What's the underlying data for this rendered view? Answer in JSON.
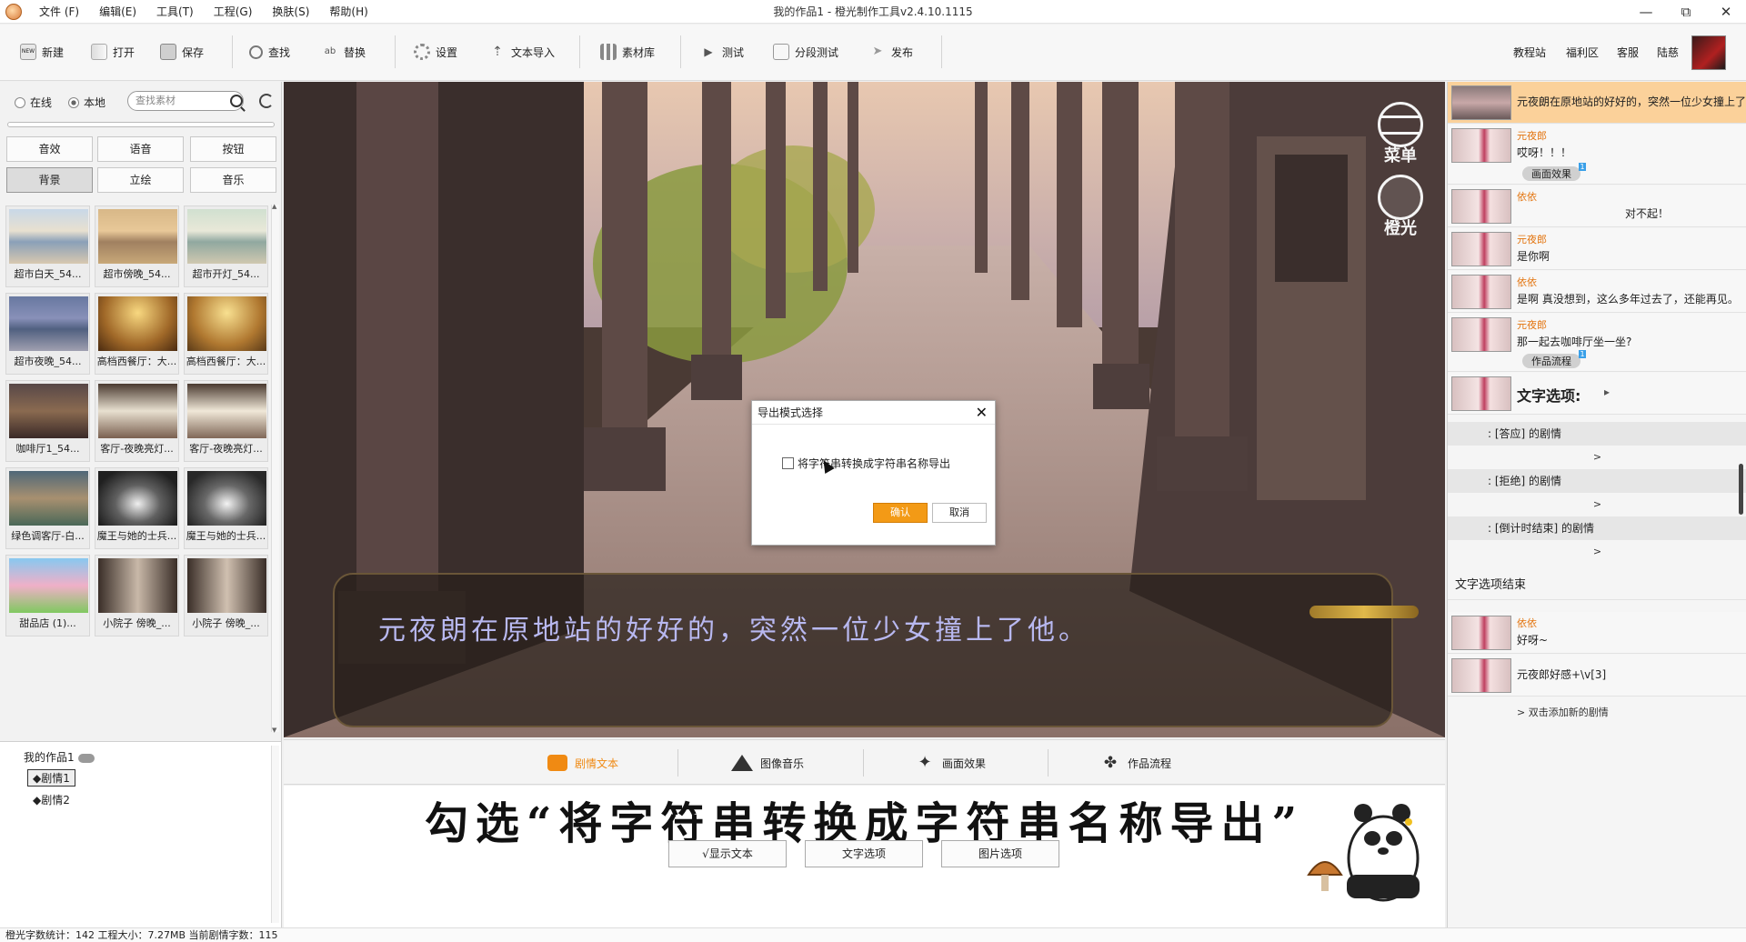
{
  "window": {
    "title": "我的作品1 - 橙光制作工具v2.4.10.1115",
    "controls": [
      "—",
      "⧉",
      "✕"
    ]
  },
  "menu": [
    "文件 (F)",
    "编辑(E)",
    "工具(T)",
    "工程(G)",
    "换肤(S)",
    "帮助(H)"
  ],
  "toolbar": {
    "new": "新建",
    "open": "打开",
    "save": "保存",
    "find": "查找",
    "replace": "替换",
    "settings": "设置",
    "text_import": "文本导入",
    "assets": "素材库",
    "test": "测试",
    "segment_test": "分段测试",
    "publish": "发布",
    "links": [
      "教程站",
      "福利区",
      "客服",
      "陆慈"
    ]
  },
  "asset_panel": {
    "source_online": "在线",
    "source_local": "本地",
    "search_placeholder": "查找素材",
    "categories": [
      "音效",
      "语音",
      "按钮",
      "背景",
      "立绘",
      "音乐"
    ],
    "active_category": "背景",
    "items": [
      "超市白天_54...",
      "超市傍晚_54...",
      "超市开灯_54...",
      "超市夜晚_54...",
      "高档西餐厅：大...",
      "高档西餐厅：大...",
      "咖啡厅1_54...",
      "客厅-夜晚亮灯...",
      "客厅-夜晚亮灯...",
      "绿色调客厅-白...",
      "魔王与她的士兵...",
      "魔王与她的士兵...",
      "甜品店 (1)...",
      "小院子 傍晚_...",
      "小院子 傍晚_..."
    ]
  },
  "project_tree": {
    "root": "我的作品1",
    "chapters": [
      "◆剧情1",
      "◆剧情2"
    ]
  },
  "preview": {
    "dialog_text": "元夜朗在原地站的好好的，突然一位少女撞上了他。",
    "menu_label": "菜单",
    "brand_label": "橙光"
  },
  "export_dialog": {
    "title": "导出模式选择",
    "close": "✕",
    "checkbox_label": "将字符串转换成字符串名称导出",
    "ok": "确认",
    "cancel": "取消"
  },
  "bottom_tabs": [
    "剧情文本",
    "图像音乐",
    "画面效果",
    "作品流程"
  ],
  "active_bottom_tab": "剧情文本",
  "editor": {
    "caption": "勾选“将字符串转换成字符串名称导出”",
    "buttons": [
      "√显示文本",
      "文字选项",
      "图片选项"
    ]
  },
  "script": {
    "rows": [
      {
        "text": "元夜朗在原地站的好好的，突然一位少女撞上了"
      },
      {
        "speaker": "元夜郎",
        "text": "哎呀！！！",
        "tag": "画面效果",
        "badge": "1"
      },
      {
        "speaker": "依依",
        "text": "对不起！"
      },
      {
        "speaker": "元夜郎",
        "text": "是你啊"
      },
      {
        "speaker": "依依",
        "text": "是啊 真没想到，这么多年过去了，还能再见。"
      },
      {
        "speaker": "元夜郎",
        "text": "那一起去咖啡厅坐一坐?",
        "tag": "作品流程",
        "badge": "1"
      }
    ],
    "option_header": "文字选项:",
    "option_arrow": "▸",
    "options": [
      ": [答应] 的剧情",
      ": [拒绝] 的剧情",
      ": [倒计时结束] 的剧情"
    ],
    "option_sub": ">",
    "option_end": "文字选项结束",
    "after": [
      {
        "speaker": "依依",
        "text": "好呀~"
      },
      {
        "text": "元夜郎好感+\\v[3]"
      }
    ],
    "add_hint": "> 双击添加新的剧情"
  },
  "status": "橙光字数统计：142 工程大小：7.27MB 当前剧情字数：115",
  "colors": {
    "accent": "#f08a13",
    "speaker": "#e3740e",
    "highlight_row": "#fbd19a"
  }
}
